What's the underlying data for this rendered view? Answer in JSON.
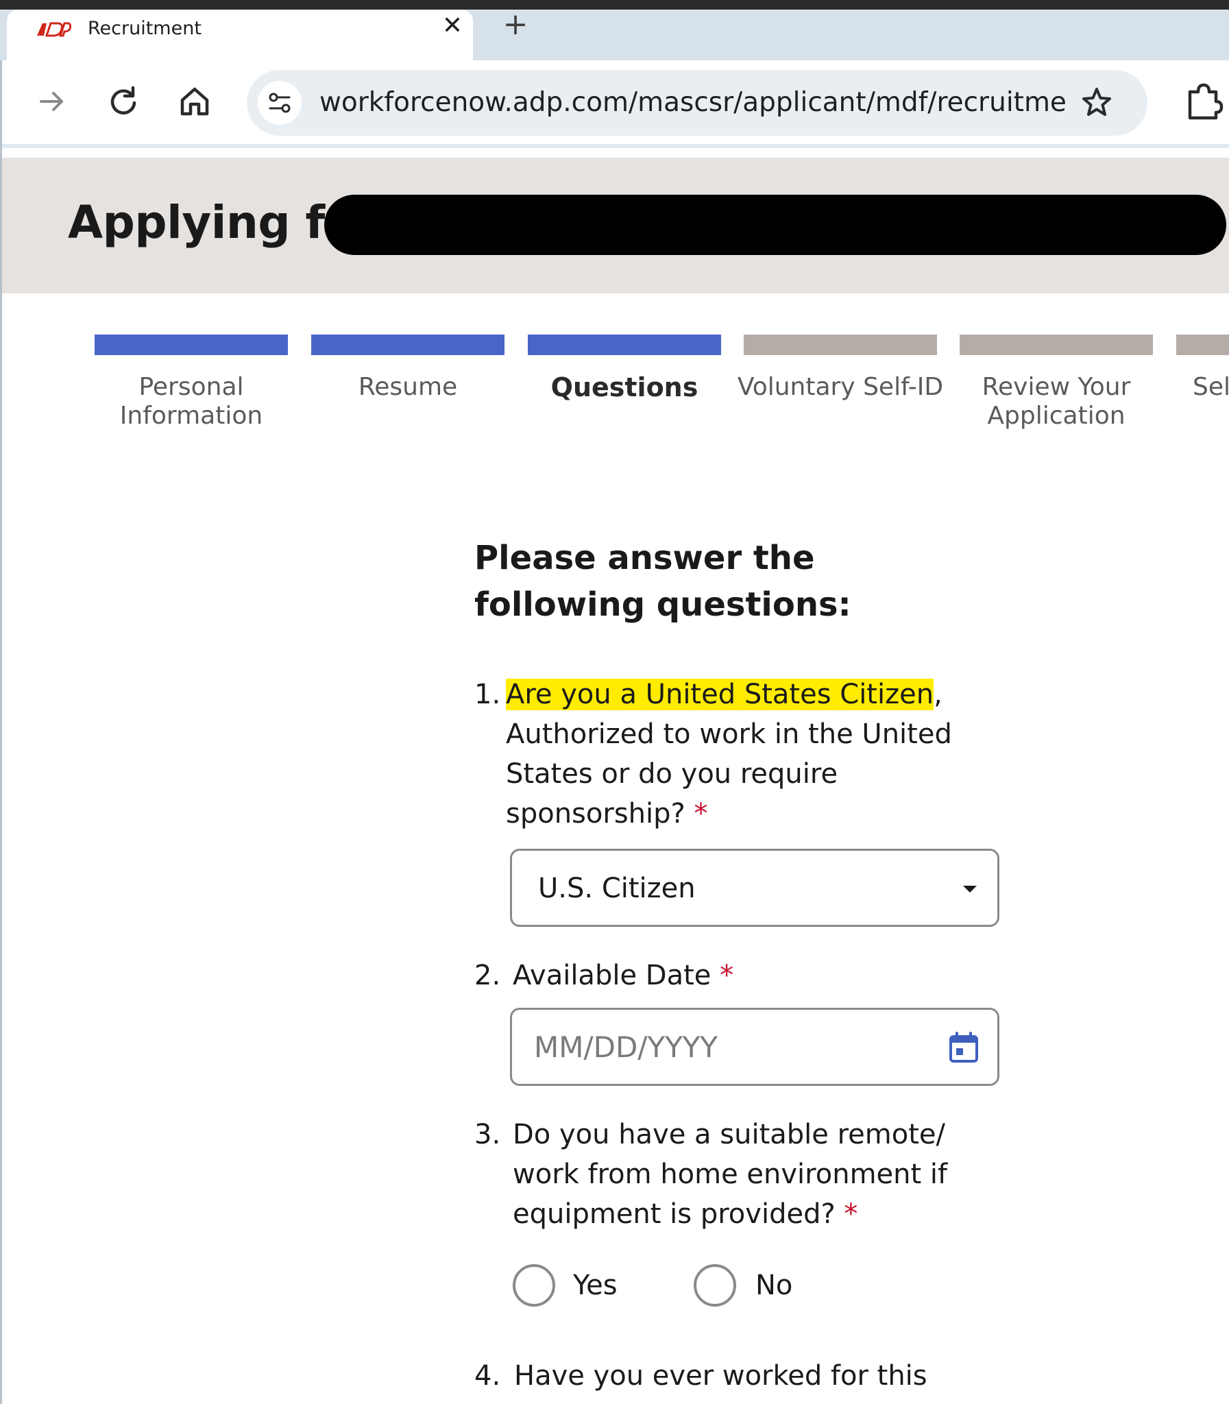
{
  "browser": {
    "tab_title": "Recruitment",
    "tab_close": "✕",
    "new_tab": "+",
    "url": "workforcenow.adp.com/mascsr/applicant/mdf/recruitment/..."
  },
  "header": {
    "title": "Applying fo"
  },
  "steps": [
    {
      "label": "Personal Information",
      "status": "done"
    },
    {
      "label": "Resume",
      "status": "done"
    },
    {
      "label": "Questions",
      "status": "current"
    },
    {
      "label": "Voluntary Self-ID",
      "status": "todo"
    },
    {
      "label": "Review Your Application",
      "status": "todo"
    },
    {
      "label": "Sel",
      "status": "todo"
    }
  ],
  "form": {
    "heading": "Please answer the following questions:",
    "questions": [
      {
        "number": "1.",
        "text_highlighted": "Are you a United States Citizen",
        "text_rest": ",  Authorized to work in the United States or do you require sponsorship?",
        "required_mark": "*",
        "selected_value": "U.S. Citizen"
      },
      {
        "number": "2.",
        "text": "Available Date",
        "required_mark": "*",
        "placeholder": "MM/DD/YYYY"
      },
      {
        "number": "3.",
        "text": "Do you have a suitable remote/ work from home environment if equipment is provided?",
        "required_mark": "*",
        "options": [
          "Yes",
          "No"
        ]
      },
      {
        "number": "4.",
        "text": "Have you ever worked for this"
      }
    ]
  },
  "colors": {
    "step_done": "#4766c8",
    "step_todo": "#b5aca7",
    "required": "#c8102e",
    "highlight": "#ffec00",
    "header_band": "#e6e2df"
  }
}
